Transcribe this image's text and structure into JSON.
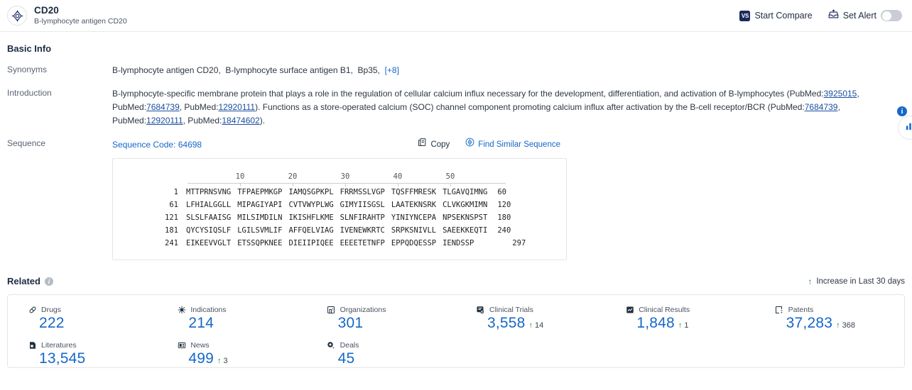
{
  "header": {
    "logo_icon": "target-icon",
    "title": "CD20",
    "subtitle": "B-lymphocyte antigen CD20",
    "start_compare": {
      "label": "Start Compare",
      "badge": "VS",
      "icon": "vs-badge-icon"
    },
    "set_alert": {
      "label": "Set Alert",
      "icon": "alert-inbox-icon",
      "toggle_on": false
    }
  },
  "basic_info": {
    "title": "Basic Info",
    "synonyms": {
      "label": "Synonyms",
      "items": [
        "B-lymphocyte antigen CD20,",
        "B-lymphocyte surface antigen B1,",
        "Bp35,"
      ],
      "more": "[+8]"
    },
    "introduction": {
      "label": "Introduction",
      "seg1": "B-lymphocyte-specific membrane protein that plays a role in the regulation of cellular calcium influx necessary for the development, differentiation, and activation of B-lymphocytes (PubMed:",
      "ref1": "3925015",
      "seg2": ", PubMed:",
      "ref2": "7684739",
      "seg3": ", PubMed:",
      "ref3": "12920111",
      "seg4": "). Functions as a store-operated calcium (SOC) channel component promoting calcium influx after activation by the B-cell receptor/BCR (PubMed:",
      "ref4": "7684739",
      "seg5": ", PubMed:",
      "ref5": "12920111",
      "seg6": ", PubMed:",
      "ref6": "18474602",
      "seg7": ")."
    }
  },
  "sequence": {
    "label": "Sequence",
    "code_label": "Sequence Code: 64698",
    "copy_label": "Copy",
    "copy_icon": "copy-icon",
    "find_similar_label": "Find Similar Sequence",
    "find_similar_icon": "find-similar-icon",
    "ruler": [
      10,
      20,
      30,
      40,
      50
    ],
    "lines": [
      {
        "start": "1",
        "blocks": [
          "MTTPRNSVNG",
          "TFPAEPMKGP",
          "IAMQSGPKPL",
          "FRRMSSLVGP",
          "TQSFFMRESK",
          "TLGAVQIMNG"
        ],
        "end": "60"
      },
      {
        "start": "61",
        "blocks": [
          "LFHIALGGLL",
          "MIPAGIYAPI",
          "CVTVWYPLWG",
          "GIMYIISGSL",
          "LAATEKNSRK",
          "CLVKGKMIMN"
        ],
        "end": "120"
      },
      {
        "start": "121",
        "blocks": [
          "SLSLFAAISG",
          "MILSIMDILN",
          "IKISHFLKME",
          "SLNFIRAHTP",
          "YINIYNCEPA",
          "NPSEKNSPST"
        ],
        "end": "180"
      },
      {
        "start": "181",
        "blocks": [
          "QYCYSIQSLF",
          "LGILSVMLIF",
          "AFFQELVIAG",
          "IVENEWKRTC",
          "SRPKSNIVLL",
          "SAEEKKEQTI"
        ],
        "end": "240"
      },
      {
        "start": "241",
        "blocks": [
          "EIKEEVVGLT",
          "ETSSQPKNEE",
          "DIEIIPIQEE",
          "EEEETETNFP",
          "EPPQDQESSP",
          "IENDSSP"
        ],
        "end": "297"
      }
    ]
  },
  "related": {
    "title": "Related",
    "info_icon": "info-icon",
    "increase_label": "Increase in Last 30 days",
    "increase_arrow": "up-arrow-icon",
    "stats": [
      {
        "label": "Drugs",
        "icon": "capsule-icon",
        "value": "222",
        "delta": null
      },
      {
        "label": "Indications",
        "icon": "virus-icon",
        "value": "214",
        "delta": null
      },
      {
        "label": "Organizations",
        "icon": "building-icon",
        "value": "301",
        "delta": null
      },
      {
        "label": "Clinical Trials",
        "icon": "clinical-trial-icon",
        "value": "3,558",
        "delta": "14"
      },
      {
        "label": "Clinical Results",
        "icon": "clinical-result-icon",
        "value": "1,848",
        "delta": "1"
      },
      {
        "label": "Patents",
        "icon": "patent-icon",
        "value": "37,283",
        "delta": "368"
      },
      {
        "label": "Literatures",
        "icon": "literature-icon",
        "value": "13,545",
        "delta": null
      },
      {
        "label": "News",
        "icon": "news-icon",
        "value": "499",
        "delta": "3"
      },
      {
        "label": "Deals",
        "icon": "deals-icon",
        "value": "45",
        "delta": null
      }
    ]
  },
  "floating": {
    "info_badge": "i",
    "chart_fab_icon": "bar-chart-icon"
  },
  "colors": {
    "link_blue": "#1667c9",
    "stat_blue": "#1667c9",
    "increase_green": "#1e8a3c",
    "title_navy": "#1b2a44"
  }
}
